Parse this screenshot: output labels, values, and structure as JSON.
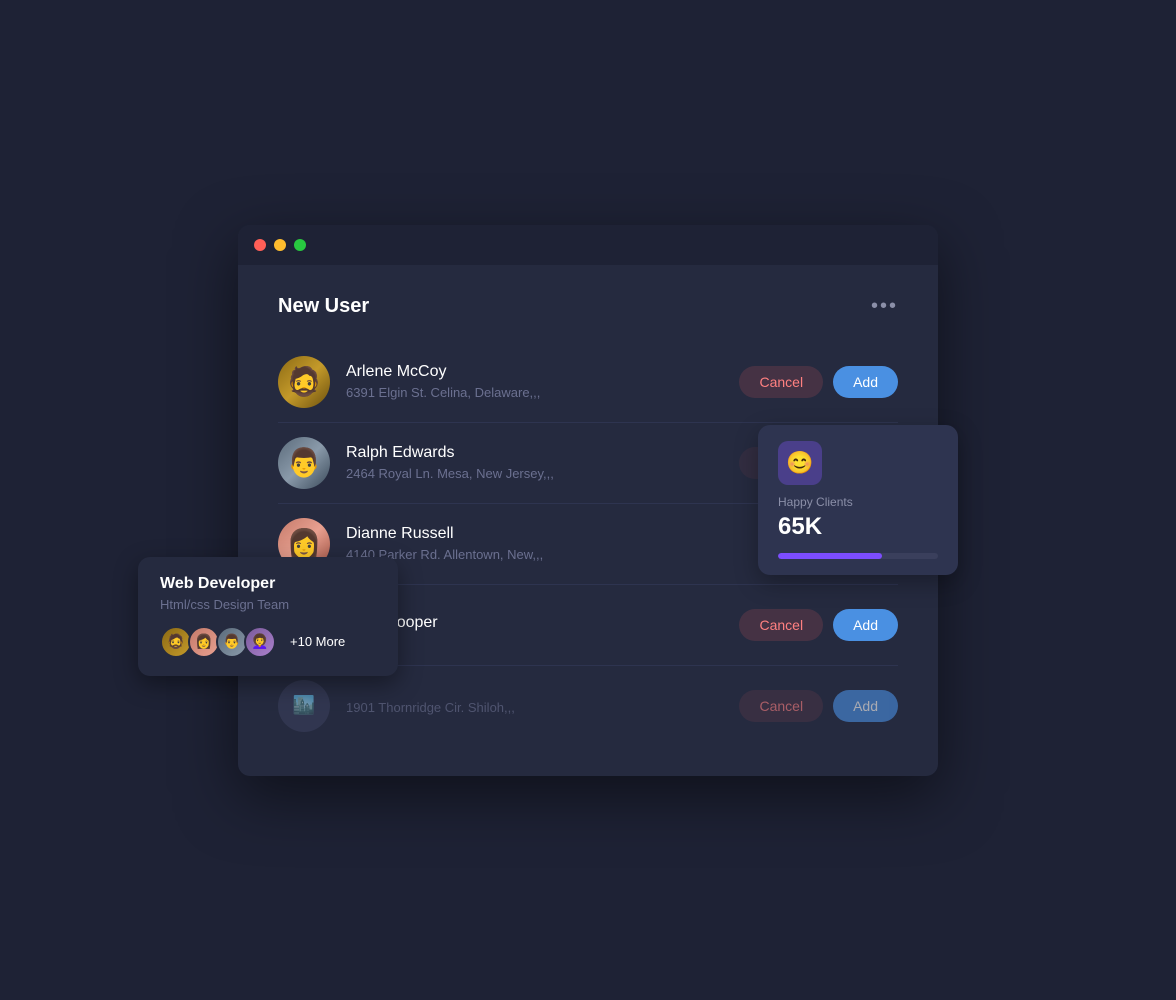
{
  "window": {
    "titlebar": {
      "dots": [
        "dot-red",
        "dot-yellow",
        "dot-green"
      ]
    }
  },
  "section": {
    "title": "New User",
    "more_label": "•••"
  },
  "users": [
    {
      "id": 1,
      "name": "Arlene McCoy",
      "address": "6391 Elgin St. Celina, Delaware,,,",
      "avatar_class": "avatar-1",
      "avatar_emoji": "🧔",
      "show_actions": true
    },
    {
      "id": 2,
      "name": "Ralph Edwards",
      "address": "2464 Royal Ln. Mesa, New Jersey,,,",
      "avatar_class": "avatar-2",
      "avatar_emoji": "👨",
      "show_actions": false,
      "partial_actions": true
    },
    {
      "id": 3,
      "name": "Dianne Russell",
      "address": "4140 Parker Rd. Allentown, New,,,",
      "avatar_class": "avatar-3",
      "avatar_emoji": "👩",
      "show_actions": false
    },
    {
      "id": 4,
      "name": "Jane Cooper",
      "address": "",
      "avatar_class": "avatar-4",
      "avatar_emoji": "👩‍🦱",
      "show_actions": true
    },
    {
      "id": 5,
      "name": "",
      "address": "1901 Thornridge Cir. Shiloh,,,",
      "avatar_class": "avatar-5",
      "avatar_emoji": "🏙️",
      "show_actions": true,
      "partial": true
    }
  ],
  "buttons": {
    "cancel": "Cancel",
    "add": "Add"
  },
  "happy_clients": {
    "label": "Happy Clients",
    "value": "65K",
    "progress": 65,
    "icon": "😊"
  },
  "web_developer": {
    "title": "Web Developer",
    "subtitle": "Html/css Design Team",
    "more_text": "+10 More"
  }
}
